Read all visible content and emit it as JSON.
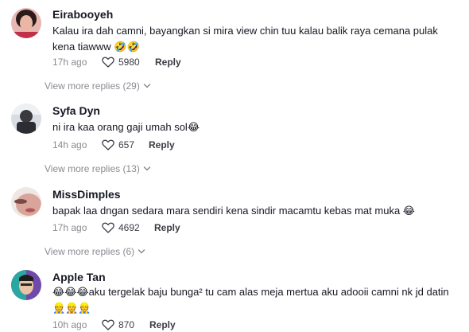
{
  "comments": [
    {
      "username": "Eirabooyeh",
      "text": "Kalau ira dah camni, bayangkan si mira view chin tuu kalau balik raya cemana pulak kena tiawww 🤣🤣",
      "time": "17h ago",
      "likes": "5980",
      "reply_label": "Reply",
      "view_more": "View more replies (29)"
    },
    {
      "username": "Syfa Dyn",
      "text": "ni ira kaa orang gaji umah sol😂",
      "time": "14h ago",
      "likes": "657",
      "reply_label": "Reply",
      "view_more": "View more replies (13)"
    },
    {
      "username": "MissDimples",
      "text": "bapak laa dngan sedara mara sendiri kena sindir macamtu kebas mat muka 😂",
      "time": "17h ago",
      "likes": "4692",
      "reply_label": "Reply",
      "view_more": "View more replies (6)"
    },
    {
      "username": "Apple Tan",
      "text": "😂😂😂aku tergelak baju bunga² tu cam alas meja mertua aku adooii camni nk jd datin👷👷👷",
      "time": "10h ago",
      "likes": "870",
      "reply_label": "Reply"
    }
  ],
  "icons": {
    "like": "heart-outline-icon",
    "expand": "chevron-down-icon"
  },
  "colors": {
    "username": "#161823",
    "secondary_text": "#8a8b91"
  }
}
